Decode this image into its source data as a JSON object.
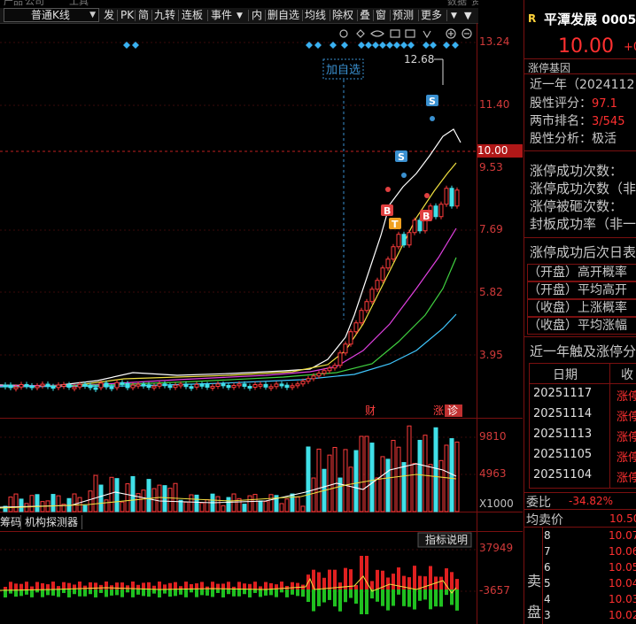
{
  "top_cut": [
    "产品",
    "公司",
    "工具",
    "",
    "数据",
    "资讯"
  ],
  "toolbar": {
    "kline_type": "普通K线",
    "items": [
      "发",
      "PK",
      "简",
      "九转",
      "连板",
      "事件",
      "内",
      "删自选",
      "均线",
      "除权",
      "叠",
      "窗",
      "预测",
      "更多"
    ]
  },
  "price_axis": [
    "13.24",
    "11.40",
    "10.00",
    "9.53",
    "7.69",
    "5.82",
    "3.95"
  ],
  "volume_axis": [
    "9810",
    "4963",
    "X1000"
  ],
  "indicator_axis": [
    "37949",
    "-3657"
  ],
  "annotations": {
    "add_watchlist": "加自选",
    "high_price": "12.68",
    "s_mark": "S",
    "b_mark": "B",
    "t_mark": "T",
    "cai_mark": "财",
    "zhang_mark": "涨",
    "zhen_mark": "诊"
  },
  "bottom_tabs": [
    "筹码",
    "机构探测器"
  ],
  "indicator_button": "指标说明",
  "colors": {
    "up": "#ff3c3c",
    "down": "#40e0e8",
    "accent": "#ffd23a",
    "border": "#7a1010"
  },
  "stock": {
    "badge": "R",
    "name": "平潭发展",
    "code": "0005",
    "price": "10.00",
    "change_partial": "+0"
  },
  "limit_up_gene": {
    "title": "涨停基因",
    "period": "近一年（2024112",
    "score_label": "股性评分：",
    "score_value": "97.1",
    "rank_label": "两市排名：",
    "rank_value": "3/545",
    "analysis_label": "股性分析：",
    "analysis_value": "极活"
  },
  "stats": [
    "涨停成功次数：",
    "涨停成功次数（非",
    "涨停被砸次数：",
    "封板成功率（非一"
  ],
  "after_title": "涨停成功后次日表",
  "after_rows": [
    "（开盘）高开概率",
    "（开盘）平均高开",
    "（收盘）上涨概率",
    "（收盘）平均涨幅"
  ],
  "touch_title": "近一年触及涨停分",
  "table": {
    "headers": [
      "日期",
      "收"
    ],
    "rows": [
      {
        "date": "20251117",
        "state": "涨停"
      },
      {
        "date": "20251114",
        "state": "涨停"
      },
      {
        "date": "20251113",
        "state": "涨停"
      },
      {
        "date": "20251105",
        "state": "涨停"
      },
      {
        "date": "20251104",
        "state": "涨停"
      }
    ]
  },
  "order": {
    "wei_label": "委比",
    "wei_value": "-34.82%",
    "avg_label": "均卖价",
    "avg_value": "10.50",
    "sell_label_1": "卖",
    "sell_label_2": "盘",
    "levels": [
      {
        "n": "8",
        "price": "10.07"
      },
      {
        "n": "7",
        "price": "10.06"
      },
      {
        "n": "6",
        "price": "10.05"
      },
      {
        "n": "5",
        "price": "10.04"
      },
      {
        "n": "4",
        "price": "10.03"
      },
      {
        "n": "3",
        "price": "10.02"
      }
    ]
  }
}
